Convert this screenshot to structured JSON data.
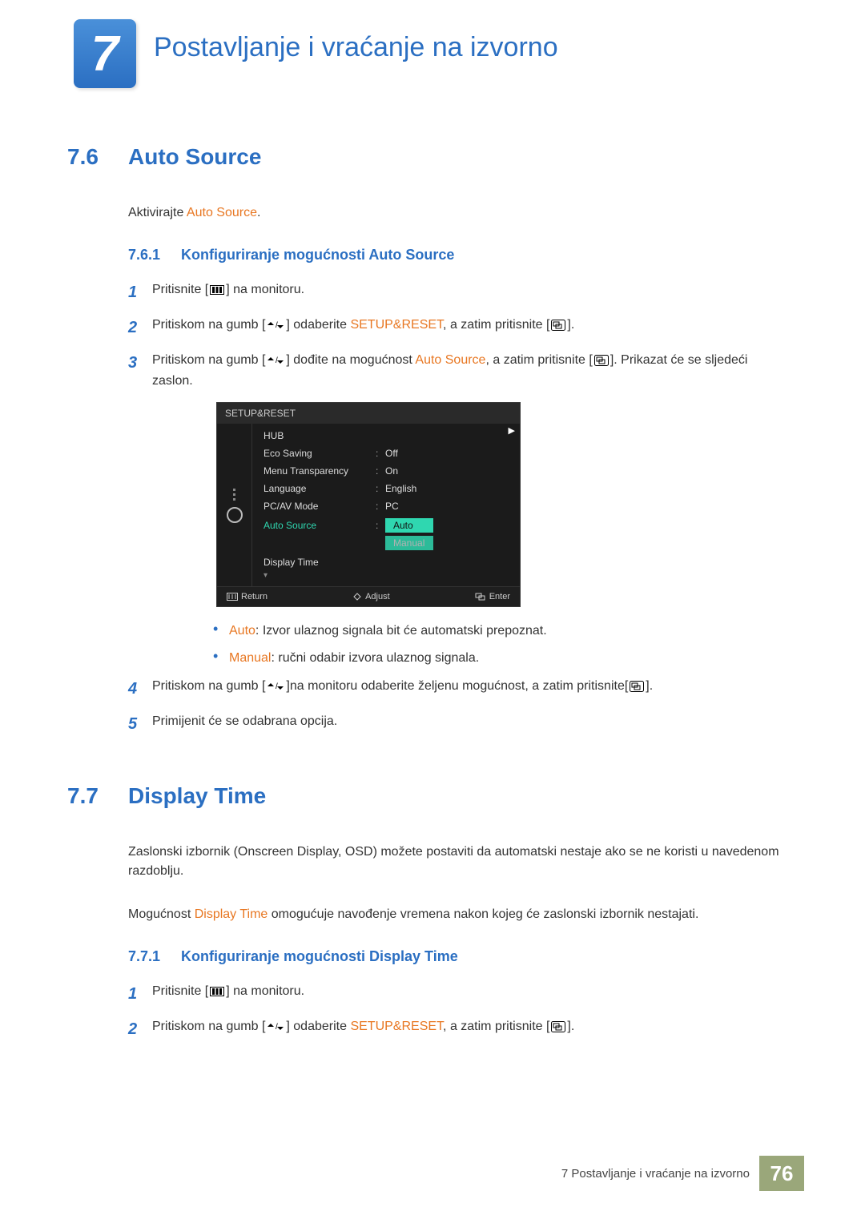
{
  "chapter": {
    "number": "7",
    "title": "Postavljanje i vraćanje na izvorno"
  },
  "section76": {
    "num": "7.6",
    "title": "Auto Source",
    "intro_pre": "Aktivirajte ",
    "intro_accent": "Auto Source",
    "intro_post": ".",
    "sub": {
      "num": "7.6.1",
      "title": "Konfiguriranje mogućnosti Auto Source"
    },
    "steps": {
      "s1": {
        "n": "1",
        "a": "Pritisnite [",
        "b": "] na monitoru."
      },
      "s2": {
        "n": "2",
        "a": "Pritiskom na gumb [",
        "b": "] odaberite ",
        "accent": "SETUP&RESET",
        "c": ", a zatim pritisnite [",
        "d": "]."
      },
      "s3": {
        "n": "3",
        "a": "Pritiskom na gumb [",
        "b": "] dođite na mogućnost ",
        "accent": "Auto Source",
        "c": ", a zatim pritisnite [",
        "d": "]. Prikazat će se sljedeći zaslon."
      },
      "s4": {
        "n": "4",
        "a": "Pritiskom na gumb [",
        "b": "]na monitoru odaberite željenu mogućnost, a zatim pritisnite[",
        "c": "]."
      },
      "s5": {
        "n": "5",
        "text": "Primijenit će se odabrana opcija."
      }
    },
    "bullets": {
      "b1": {
        "accent": "Auto",
        "text": ": Izvor ulaznog signala bit će automatski prepoznat."
      },
      "b2": {
        "accent": "Manual",
        "text": ": ručni odabir izvora ulaznog signala."
      }
    }
  },
  "osd": {
    "header": "SETUP&RESET",
    "rows": {
      "hub": "HUB",
      "eco": "Eco Saving",
      "eco_v": "Off",
      "menu": "Menu Transparency",
      "menu_v": "On",
      "lang": "Language",
      "lang_v": "English",
      "pcav": "PC/AV Mode",
      "pcav_v": "PC",
      "auto": "Auto Source",
      "auto_v": "Auto",
      "auto_v2": "Manual",
      "disp": "Display Time"
    },
    "footer": {
      "return": "Return",
      "adjust": "Adjust",
      "enter": "Enter"
    }
  },
  "section77": {
    "num": "7.7",
    "title": "Display Time",
    "p1": "Zaslonski izbornik (Onscreen Display, OSD) možete postaviti da automatski nestaje ako se ne koristi u navedenom razdoblju.",
    "p2_pre": "Mogućnost ",
    "p2_accent": "Display Time",
    "p2_post": " omogućuje navođenje vremena nakon kojeg će zaslonski izbornik nestajati.",
    "sub": {
      "num": "7.7.1",
      "title": "Konfiguriranje mogućnosti Display Time"
    },
    "steps": {
      "s1": {
        "n": "1",
        "a": "Pritisnite [",
        "b": "] na monitoru."
      },
      "s2": {
        "n": "2",
        "a": "Pritiskom na gumb [",
        "b": "] odaberite ",
        "accent": "SETUP&RESET",
        "c": ", a zatim pritisnite [",
        "d": "]."
      }
    }
  },
  "footer": {
    "text": "7 Postavljanje i vraćanje na izvorno",
    "page": "76"
  }
}
